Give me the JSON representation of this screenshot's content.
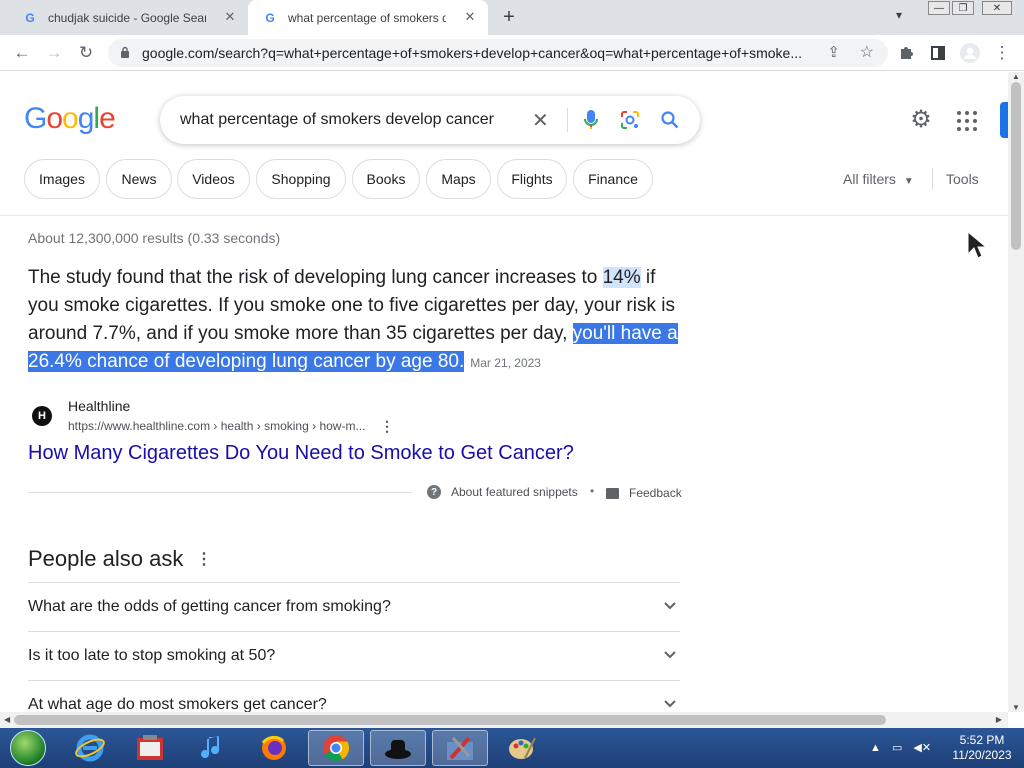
{
  "browser": {
    "tabs": [
      {
        "title": "chudjak suicide - Google Search",
        "active": false
      },
      {
        "title": "what percentage of smokers develop cancer - Google Search",
        "active": true
      }
    ],
    "url": "google.com/search?q=what+percentage+of+smokers+develop+cancer&oq=what+percentage+of+smoke...",
    "icons": {
      "back": "back-arrow-icon",
      "forward": "forward-arrow-icon",
      "reload": "reload-icon",
      "lock": "lock-icon",
      "share": "share-icon",
      "bookmark": "star-icon",
      "extensions": "puzzle-icon",
      "sidepanel": "side-panel-icon",
      "profile": "profile-icon",
      "menu": "kebab-menu-icon"
    }
  },
  "google": {
    "logo": "Google",
    "query": "what percentage of smokers develop cancer",
    "chips": [
      "Images",
      "News",
      "Videos",
      "Shopping",
      "Books",
      "Maps",
      "Flights",
      "Finance"
    ],
    "all_filters": "All filters",
    "tools": "Tools",
    "stats": "About 12,300,000 results (0.33 seconds)"
  },
  "featured": {
    "text_a": "The study found that the risk of developing lung cancer increases to ",
    "text_pct": "14%",
    "text_b": " if you smoke cigarettes. If you smoke one to five cigarettes per day, your risk is around 7.7%, and if you smoke more than 35 cigarettes per day, ",
    "text_highlight": "you'll have a 26.4% chance of developing lung cancer by age 80.",
    "date": "Mar 21, 2023",
    "source_name": "Healthline",
    "source_icon_letter": "H",
    "source_cite": "https://www.healthline.com › health › smoking › how-m...",
    "result_title": "How Many Cigarettes Do You Need to Smoke to Get Cancer?",
    "about": "About featured snippets",
    "dot": "•",
    "feedback": "Feedback"
  },
  "paa": {
    "title": "People also ask",
    "questions": [
      "What are the odds of getting cancer from smoking?",
      "Is it too late to stop smoking at 50?",
      "At what age do most smokers get cancer?"
    ]
  },
  "taskbar": {
    "apps": [
      "internet-explorer",
      "media-app",
      "music-app",
      "firefox",
      "chrome",
      "hat-app",
      "tools-app",
      "paint-app"
    ],
    "time": "5:52 PM",
    "date": "11/20/2023"
  },
  "colors": {
    "google_blue": "#4285f4",
    "google_red": "#ea4335",
    "google_yellow": "#fbbc05",
    "google_green": "#34a853",
    "link": "#1a0dab",
    "highlight": "#3b78e7"
  }
}
